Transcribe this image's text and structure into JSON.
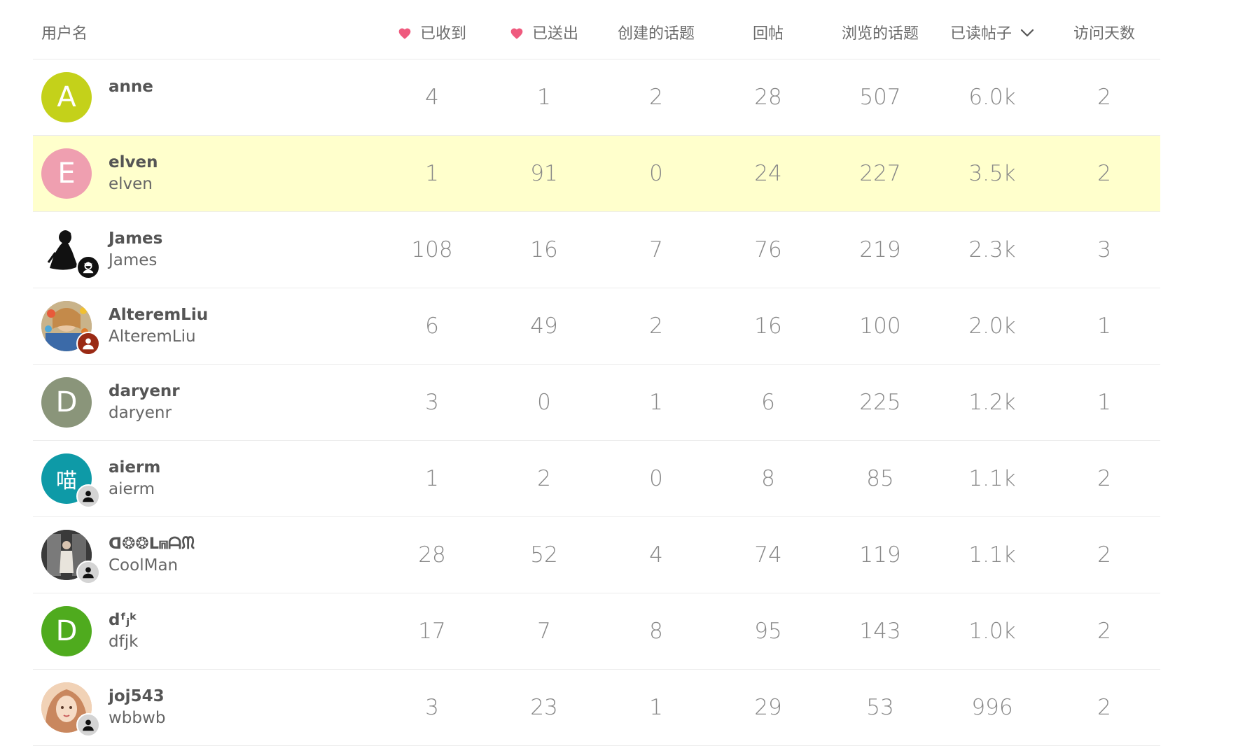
{
  "columns": {
    "username": "用户名",
    "likes_received": "已收到",
    "likes_given": "已送出",
    "topics_created": "创建的话题",
    "replies": "回帖",
    "topics_viewed": "浏览的话题",
    "posts_read": "已读帖子",
    "days_visited": "访问天数"
  },
  "sort": {
    "column": "posts_read",
    "direction": "desc",
    "icon": "chevron-down-icon"
  },
  "colors": {
    "heart": "#ef5a7e",
    "highlight_row": "#ffffcc"
  },
  "users": [
    {
      "username": "anne",
      "full_name": "",
      "avatar_letter": "A",
      "avatar_color": "#c4d11a",
      "avatar_type": "letter",
      "badge": "",
      "likes_received": "4",
      "likes_given": "1",
      "topics_created": "2",
      "replies": "28",
      "topics_viewed": "507",
      "posts_read": "6.0k",
      "days_visited": "2"
    },
    {
      "username": "elven",
      "full_name": "elven",
      "avatar_letter": "E",
      "avatar_color": "#ef9fb0",
      "avatar_type": "letter",
      "badge": "",
      "highlighted": true,
      "likes_received": "1",
      "likes_given": "91",
      "topics_created": "0",
      "replies": "24",
      "topics_viewed": "227",
      "posts_read": "3.5k",
      "days_visited": "2"
    },
    {
      "username": "James",
      "full_name": "James",
      "avatar_letter": "",
      "avatar_color": "#ffffff",
      "avatar_type": "silhouette",
      "badge": "crown",
      "likes_received": "108",
      "likes_given": "16",
      "topics_created": "7",
      "replies": "76",
      "topics_viewed": "219",
      "posts_read": "2.3k",
      "days_visited": "3"
    },
    {
      "username": "AlteremLiu",
      "full_name": "AlteremLiu",
      "avatar_letter": "",
      "avatar_color": "#b9a27d",
      "avatar_type": "photo-colorful",
      "badge": "user-red",
      "likes_received": "6",
      "likes_given": "49",
      "topics_created": "2",
      "replies": "16",
      "topics_viewed": "100",
      "posts_read": "2.0k",
      "days_visited": "1"
    },
    {
      "username": "daryenr",
      "full_name": "daryenr",
      "avatar_letter": "D",
      "avatar_color": "#8a957a",
      "avatar_type": "letter",
      "badge": "",
      "likes_received": "3",
      "likes_given": "0",
      "topics_created": "1",
      "replies": "6",
      "topics_viewed": "225",
      "posts_read": "1.2k",
      "days_visited": "1"
    },
    {
      "username": "aierm",
      "full_name": "aierm",
      "avatar_letter": "喵",
      "avatar_color": "#0e9aa7",
      "avatar_type": "letter",
      "badge": "user-grey",
      "likes_received": "1",
      "likes_given": "2",
      "topics_created": "0",
      "replies": "8",
      "topics_viewed": "85",
      "posts_read": "1.1k",
      "days_visited": "2"
    },
    {
      "username": "ᗡ❂❂ᒪ⩎ᗩᙏ",
      "full_name": "CoolMan",
      "avatar_letter": "",
      "avatar_color": "#4b4b4b",
      "avatar_type": "photo-dark",
      "badge": "user-grey",
      "likes_received": "28",
      "likes_given": "52",
      "topics_created": "4",
      "replies": "74",
      "topics_viewed": "119",
      "posts_read": "1.1k",
      "days_visited": "2"
    },
    {
      "username": "dᶠⱼᵏ",
      "full_name": "dfjk",
      "avatar_letter": "D",
      "avatar_color": "#4fab1e",
      "avatar_type": "letter",
      "badge": "",
      "likes_received": "17",
      "likes_given": "7",
      "topics_created": "8",
      "replies": "95",
      "topics_viewed": "143",
      "posts_read": "1.0k",
      "days_visited": "2"
    },
    {
      "username": "joj543",
      "full_name": "wbbwb",
      "avatar_letter": "",
      "avatar_color": "#e8b89a",
      "avatar_type": "photo-portrait",
      "badge": "user-grey",
      "likes_received": "3",
      "likes_given": "23",
      "topics_created": "1",
      "replies": "29",
      "topics_viewed": "53",
      "posts_read": "996",
      "days_visited": "2"
    }
  ]
}
